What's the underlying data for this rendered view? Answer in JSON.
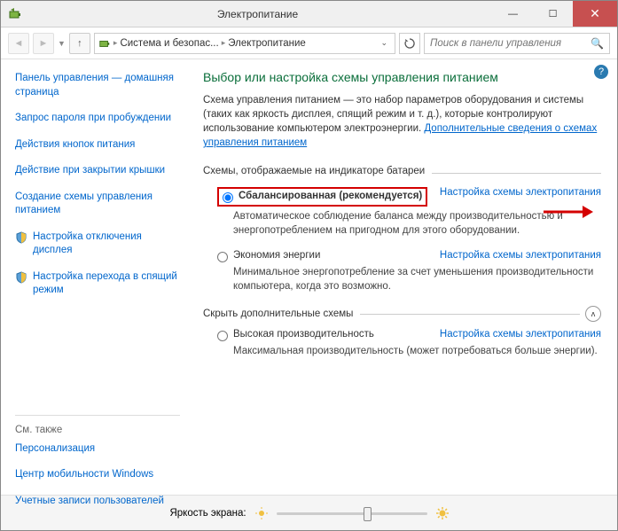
{
  "window": {
    "title": "Электропитание",
    "controls": {
      "min": "—",
      "max": "☐",
      "close": "✕"
    }
  },
  "nav": {
    "breadcrumb": {
      "item1": "Система и безопас...",
      "item2": "Электропитание"
    },
    "search_placeholder": "Поиск в панели управления"
  },
  "sidebar": {
    "home": "Панель управления — домашняя страница",
    "items": [
      "Запрос пароля при пробуждении",
      "Действия кнопок питания",
      "Действие при закрытии крышки",
      "Создание схемы управления питанием",
      "Настройка отключения дисплея",
      "Настройка перехода в спящий режим"
    ],
    "see_also_heading": "См. также",
    "see_also": [
      "Персонализация",
      "Центр мобильности Windows",
      "Учетные записи пользователей"
    ]
  },
  "main": {
    "heading": "Выбор или настройка схемы управления питанием",
    "intro": "Схема управления питанием — это набор параметров оборудования и системы (таких как яркость дисплея, спящий режим и т. д.), которые контролируют использование компьютером электроэнергии. ",
    "intro_link": "Дополнительные сведения о схемах управления питанием",
    "group1_label": "Схемы, отображаемые на индикаторе батареи",
    "plan1": {
      "name": "Сбалансированная (рекомендуется)",
      "link": "Настройка схемы электропитания",
      "desc": "Автоматическое соблюдение баланса между производительностью и энергопотреблением на пригодном для этого оборудовании."
    },
    "plan2": {
      "name": "Экономия энергии",
      "link": "Настройка схемы электропитания",
      "desc": "Минимальное энергопотребление за счет уменьшения производительности компьютера, когда это возможно."
    },
    "collapse_label": "Скрыть дополнительные схемы",
    "plan3": {
      "name": "Высокая производительность",
      "link": "Настройка схемы электропитания",
      "desc": "Максимальная производительность (может потребоваться больше энергии)."
    }
  },
  "footer": {
    "label": "Яркость экрана:"
  }
}
